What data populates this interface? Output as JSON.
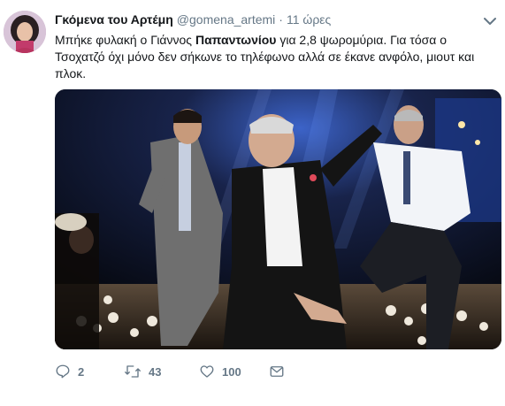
{
  "tweet": {
    "author_name": "Γκόμενα του Αρτέμη",
    "author_handle": "@gomena_artemi",
    "separator": "·",
    "time": "11 ώρες",
    "text_part1": "Μπήκε φυλακή ο Γιάννος ",
    "text_bold": "Παπαντωνίου",
    "text_part2": " για 2,8 ψωρομύρια. Για τόσα ο Τσοχατζό όχι μόνο δεν σήκωνε το τηλέφωνο αλλά σε έκανε ανφόλο, μιουτ και πλοκ.",
    "media_description": "photo"
  },
  "actions": {
    "reply_icon": "reply-icon",
    "reply_count": "2",
    "retweet_icon": "retweet-icon",
    "retweet_count": "43",
    "like_icon": "heart-icon",
    "like_count": "100",
    "dm_icon": "envelope-icon"
  },
  "colors": {
    "text": "#14171a",
    "secondary": "#657786",
    "background": "#ffffff"
  }
}
